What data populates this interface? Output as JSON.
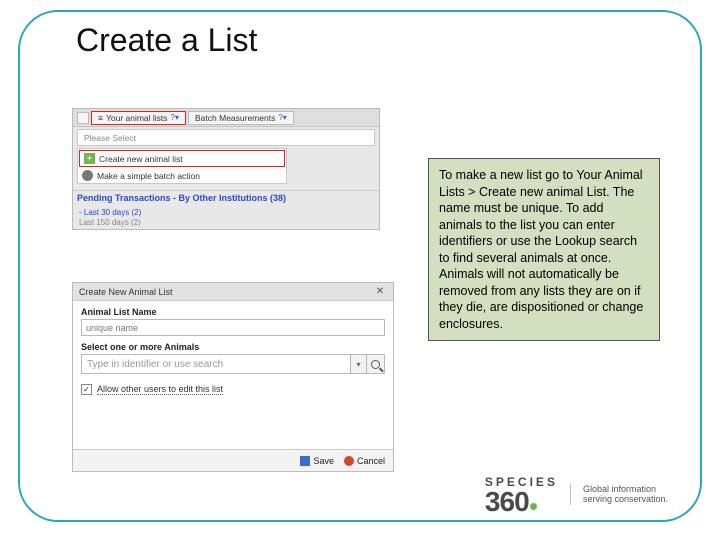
{
  "title": "Create a List",
  "top": {
    "your_lists": "Your animal lists",
    "batch": "Batch Measurements",
    "please_select": "Please Select",
    "create_new": "Create new animal list",
    "simple_batch": "Make a simple batch action",
    "pending": "Pending Transactions - By Other Institutions (38)",
    "last30": "- Last 30 days (2)",
    "last150": "Last 150 days (2)"
  },
  "dlg": {
    "title": "Create New Animal List",
    "name_label": "Animal List Name",
    "name_value": "unique name",
    "select_label": "Select one or more Animals",
    "combo_placeholder": "Type in identifier or use search",
    "allow_label": "Allow other users to edit this list",
    "save": "Save",
    "cancel": "Cancel"
  },
  "explain": "To make a new list go to Your Animal Lists > Create new animal List. The name must be unique. To add animals to the list you can enter identifiers or use the Lookup search to find several animals at once. Animals will not automatically be removed from any lists they are on if they die, are dispositioned or change enclosures.",
  "logo": {
    "species": "SPECIES",
    "num": "36",
    "tag1": "Global information",
    "tag2": "serving conservation."
  }
}
